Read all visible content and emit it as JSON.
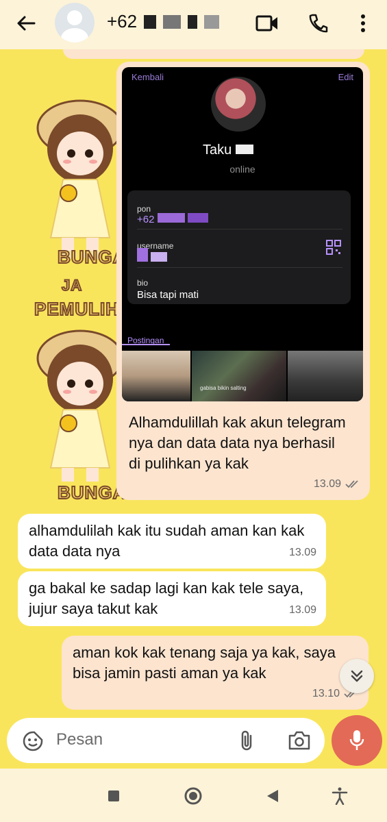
{
  "header": {
    "contact_name": "+62",
    "back_icon": "arrow-left-icon",
    "avatar_icon": "default-avatar-icon",
    "video_icon": "video-call-icon",
    "phone_icon": "phone-icon",
    "menu_icon": "more-vert-icon"
  },
  "wallpaper": {
    "texts": [
      "BUNGA",
      "PEMULIHA",
      "BUNGA"
    ]
  },
  "messages": [
    {
      "direction": "out",
      "has_image": true,
      "text": "Alhamdulillah kak akun telegram nya dan data data nya berhasil di pulihkan ya kak",
      "time": "13.09",
      "status": "read"
    },
    {
      "direction": "in",
      "text": "alhamdulilah kak itu sudah aman kan kak data data nya",
      "time": "13.09"
    },
    {
      "direction": "in",
      "text": "ga bakal ke sadap lagi kan kak tele saya, jujur saya takut kak",
      "time": "13.09"
    },
    {
      "direction": "out",
      "text": "aman kok kak tenang saja ya kak, saya bisa jamin pasti aman ya kak",
      "time": "13.10",
      "status": "read"
    }
  ],
  "telegram_screenshot": {
    "back_label": "Kembali",
    "edit_label": "Edit",
    "name": "Taku",
    "status": "online",
    "phone_label": "pon",
    "phone_value": "+62",
    "username_label": "username",
    "bio_label": "bio",
    "bio_value": "Bisa tapi mati",
    "posts_tab": "Postingan",
    "thumb_caption": "gabisa bikin salting"
  },
  "composer": {
    "placeholder": "Pesan",
    "emoji_icon": "sticker-emoji-icon",
    "attach_icon": "paperclip-icon",
    "camera_icon": "camera-icon",
    "mic_icon": "microphone-icon"
  },
  "scroll_button_icon": "double-chevron-down-icon",
  "navbar": {
    "icons": [
      "recent-apps-icon",
      "home-icon",
      "back-icon",
      "accessibility-icon"
    ]
  },
  "colors": {
    "outgoing_bubble": "#fce4cf",
    "incoming_bubble": "#ffffff",
    "header_bg": "#fdf3d8",
    "mic_button": "#e36a57",
    "telegram_accent": "#b792ff"
  }
}
